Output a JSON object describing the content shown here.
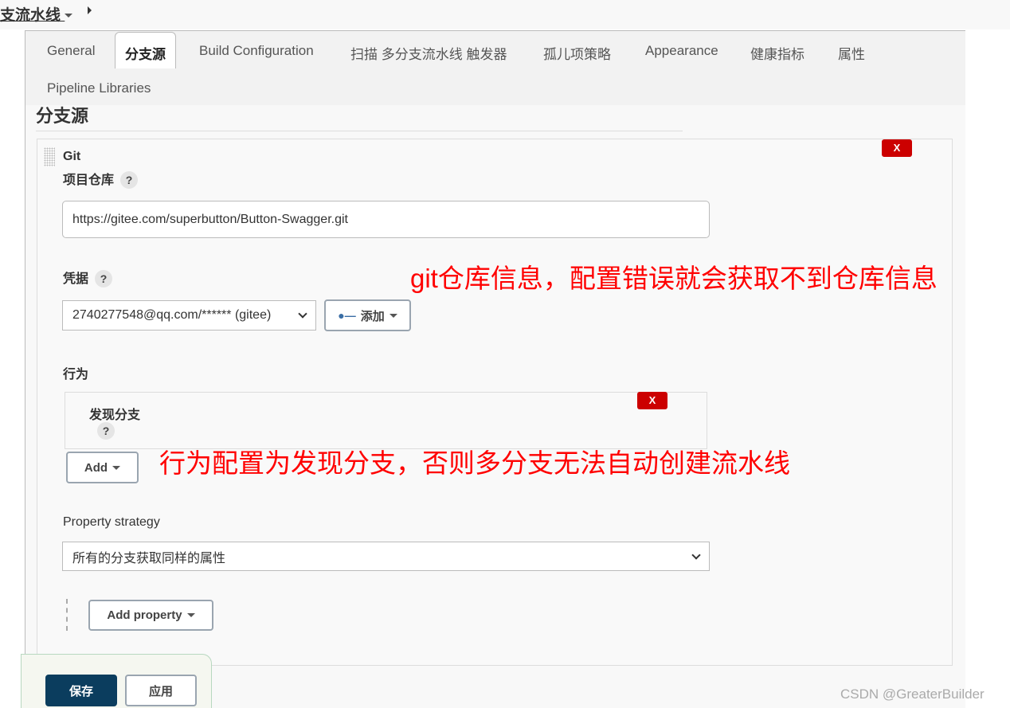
{
  "breadcrumb": {
    "label": "支流水线"
  },
  "tabs": [
    {
      "label": "General"
    },
    {
      "label": "分支源",
      "active": true
    },
    {
      "label": "Build Configuration"
    },
    {
      "label": "扫描 多分支流水线 触发器"
    },
    {
      "label": "孤儿项策略"
    },
    {
      "label": "Appearance"
    },
    {
      "label": "健康指标"
    },
    {
      "label": "属性"
    },
    {
      "label": "Pipeline Libraries"
    }
  ],
  "section": {
    "title": "分支源"
  },
  "git": {
    "title": "Git",
    "delete": "X",
    "repo_label": "项目仓库",
    "help": "?",
    "repo_value": "https://gitee.com/superbutton/Button-Swagger.git",
    "cred_label": "凭据",
    "cred_value": "2740277548@qq.com/****** (gitee)",
    "add_label": "添加",
    "behavior_label": "行为",
    "behavior_item": "发现分支",
    "add": "Add",
    "property_label": "Property strategy",
    "property_value": "所有的分支获取同样的属性",
    "add_property": "Add property"
  },
  "annotations": {
    "repo_note": "git仓库信息，配置错误就会获取不到仓库信息",
    "behavior_note": "行为配置为发现分支，否则多分支无法自动创建流水线"
  },
  "footer": {
    "save": "保存",
    "apply": "应用"
  },
  "watermark": "CSDN @GreaterBuilder",
  "colors": {
    "save": "#0b3d5e",
    "delete": "#cc0000",
    "annotation": "#ff0000"
  }
}
